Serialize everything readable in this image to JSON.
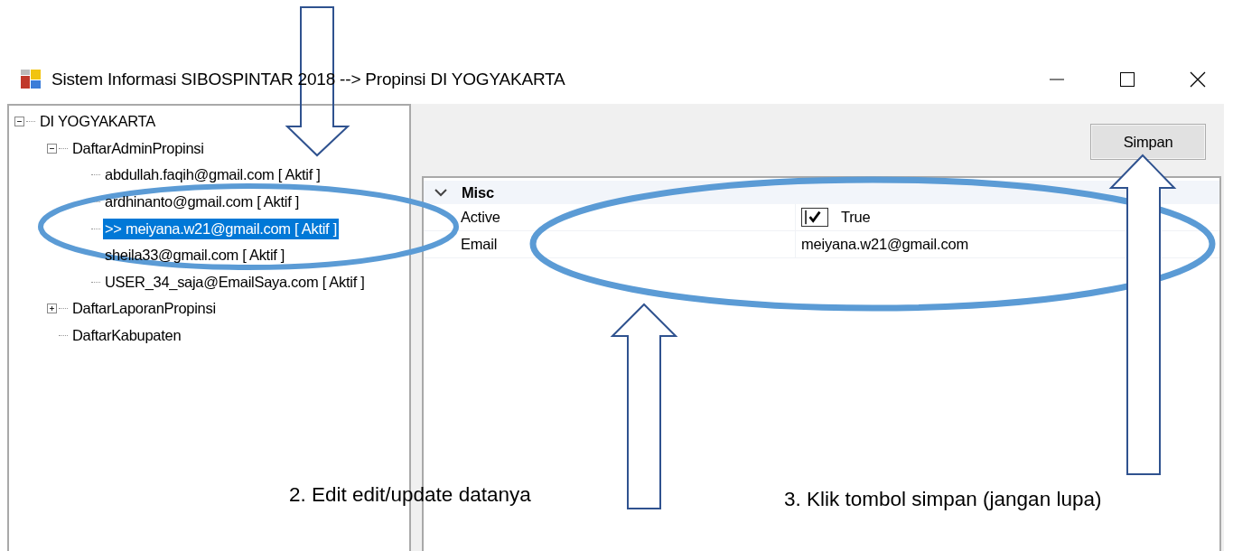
{
  "window": {
    "title": "Sistem Informasi SIBOSPINTAR 2018 --> Propinsi DI YOGYAKARTA"
  },
  "tree": [
    {
      "label": "DI YOGYAKARTA",
      "expanded": true,
      "selected": false,
      "children": [
        {
          "label": "DaftarAdminPropinsi",
          "expanded": true,
          "selected": false,
          "children": [
            {
              "label": "abdullah.faqih@gmail.com [ Aktif ]",
              "selected": false
            },
            {
              "label": "ardhinanto@gmail.com [ Aktif ]",
              "selected": false
            },
            {
              "label": ">> meiyana.w21@gmail.com [ Aktif ]",
              "selected": true
            },
            {
              "label": "sheila33@gmail.com [ Aktif ]",
              "selected": false
            },
            {
              "label": "USER_34_saja@EmailSaya.com [ Aktif ]",
              "selected": false
            }
          ]
        },
        {
          "label": "DaftarLaporanPropinsi",
          "expanded": false,
          "selected": false
        },
        {
          "label": "DaftarKabupaten",
          "selected": false
        }
      ]
    }
  ],
  "save_button": "Simpan",
  "property_grid": {
    "category": "Misc",
    "expanded": true,
    "properties": [
      {
        "kind": "checkbox",
        "name": "Active",
        "checked": true,
        "value": "True"
      },
      {
        "kind": "text",
        "name": "Email",
        "value": "meiyana.w21@gmail.com"
      }
    ]
  },
  "annotations": [
    "2. Edit edit/update datanya",
    "3. Klik tombol simpan (jangan lupa)"
  ]
}
